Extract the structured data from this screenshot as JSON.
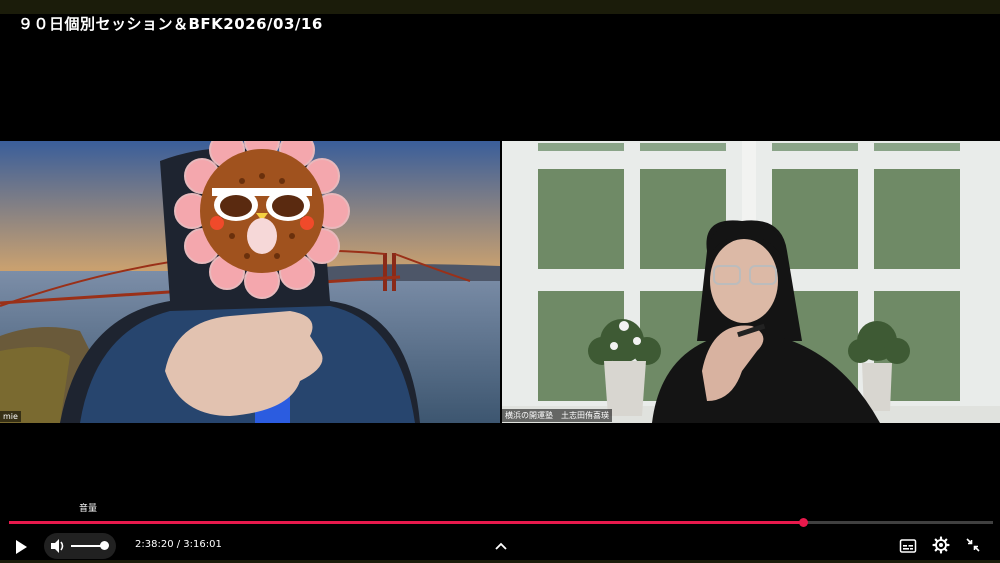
{
  "title": "９０日個別セッション＆BFK2026/03/16",
  "participants": [
    {
      "name": "mie"
    },
    {
      "name": "横浜の開運塾　土志田侑喜瑛"
    }
  ],
  "volume_tooltip": "音量",
  "player": {
    "current_time": "2:38:20",
    "separator": " / ",
    "duration": "3:16:01",
    "progress_fraction": 0.807,
    "volume_fraction": 1.0,
    "accent_color": "#e8194c"
  },
  "icons": {
    "play": "play-icon",
    "volume": "volume-icon",
    "chevron": "chevron-up-icon",
    "captions": "captions-icon",
    "settings": "gear-icon",
    "exit_fullscreen": "exit-fullscreen-icon"
  }
}
